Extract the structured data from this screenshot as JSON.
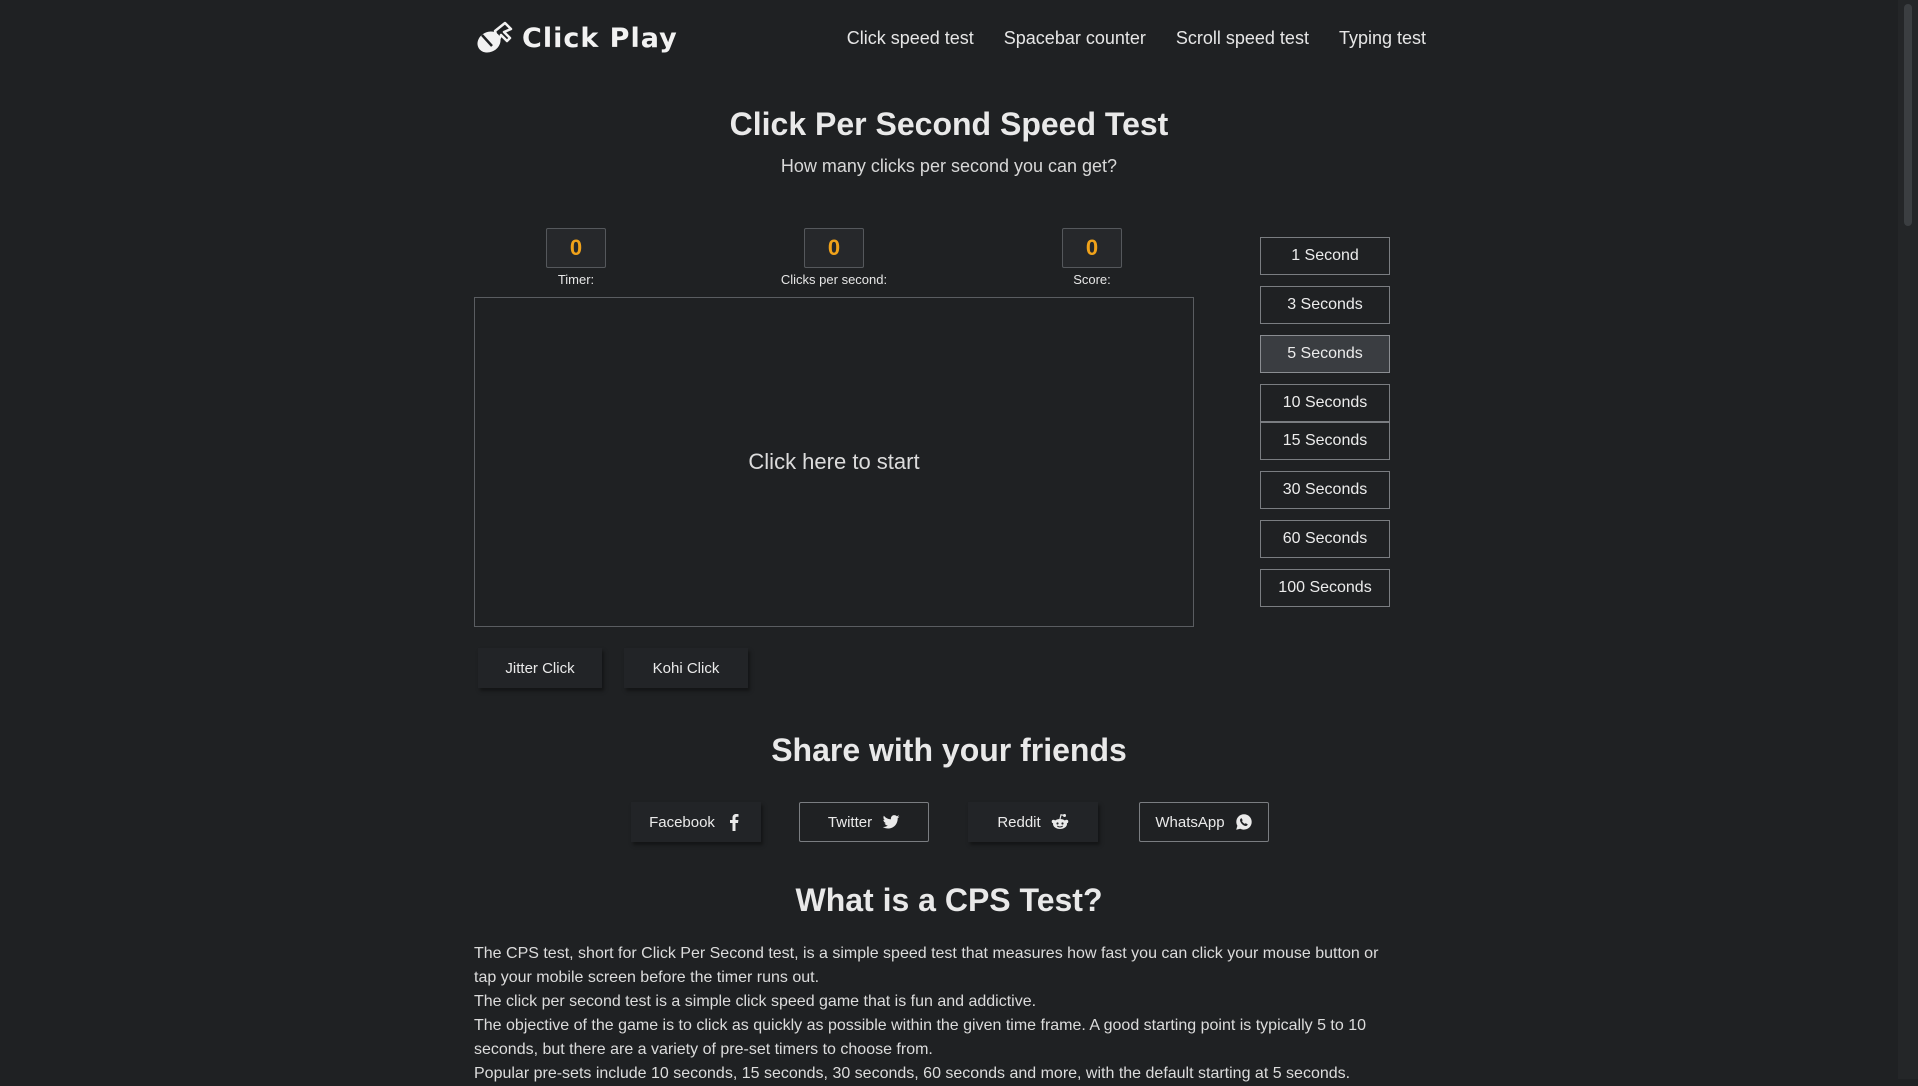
{
  "brand": {
    "name": "Click Play",
    "icon": "mouse-cursor-icon"
  },
  "nav": [
    {
      "label": "Click speed test"
    },
    {
      "label": "Spacebar counter"
    },
    {
      "label": "Scroll speed test"
    },
    {
      "label": "Typing test"
    }
  ],
  "hero": {
    "title": "Click Per Second Speed Test",
    "subtitle": "How many clicks per second you can get?"
  },
  "stats": {
    "timer": {
      "value": "0",
      "label": "Timer:"
    },
    "cps": {
      "value": "0",
      "label": "Clicks per second:"
    },
    "score": {
      "value": "0",
      "label": "Score:"
    }
  },
  "click_area": {
    "label": "Click here to start"
  },
  "timers": [
    {
      "label": "1 Second"
    },
    {
      "label": "3 Seconds"
    },
    {
      "label": "5 Seconds",
      "selected": true
    },
    {
      "label": "10 Seconds"
    },
    {
      "label": "15 Seconds"
    },
    {
      "label": "30 Seconds"
    },
    {
      "label": "60 Seconds"
    },
    {
      "label": "100 Seconds"
    }
  ],
  "modes": [
    {
      "label": "Jitter Click"
    },
    {
      "label": "Kohi Click"
    }
  ],
  "share": {
    "title": "Share with your friends",
    "buttons": [
      {
        "label": "Facebook",
        "icon": "facebook-icon"
      },
      {
        "label": "Twitter",
        "icon": "twitter-icon"
      },
      {
        "label": "Reddit",
        "icon": "reddit-icon"
      },
      {
        "label": "WhatsApp",
        "icon": "whatsapp-icon"
      }
    ]
  },
  "about": {
    "title": "What is a CPS Test?",
    "paragraphs": [
      "The CPS test, short for Click Per Second test, is a simple speed test that measures how fast you can click your mouse button or tap your mobile screen before the timer runs out.",
      "The click per second test is a simple click speed game that is fun and addictive.",
      "The objective of the game is to click as quickly as possible within the given time frame. A good starting point is typically 5 to 10 seconds, but there are a variety of pre-set timers to choose from.",
      "Popular pre-sets include 10 seconds, 15 seconds, 30 seconds, 60 seconds and more, with the default starting at 5 seconds."
    ]
  },
  "colors": {
    "background": "#1f2123",
    "accent": "#f0a21a",
    "text": "#e6e6e6"
  }
}
